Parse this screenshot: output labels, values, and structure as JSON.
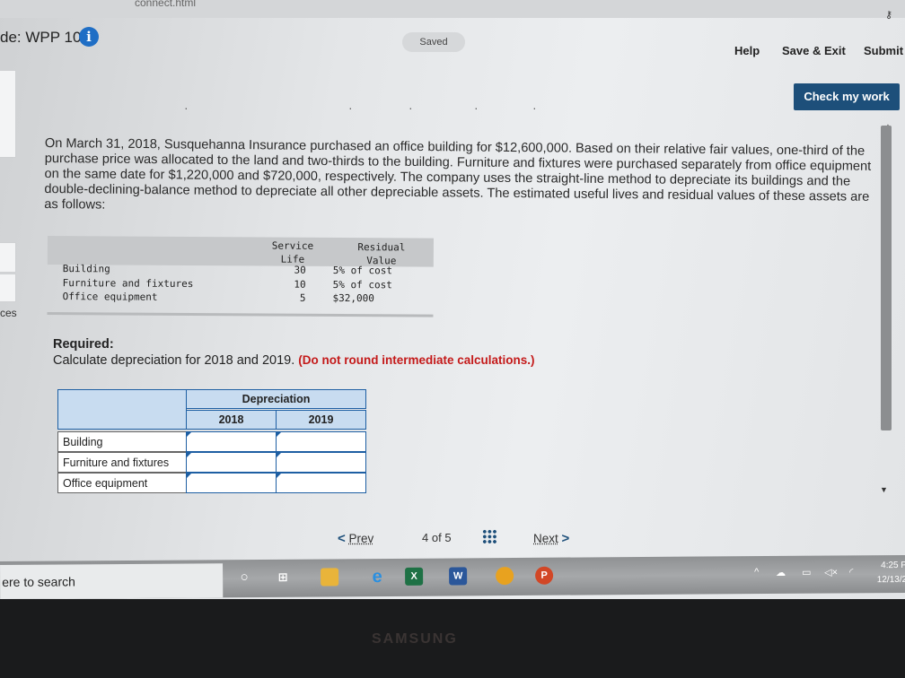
{
  "browser": {
    "url_fragment": "connect.html",
    "key_icon": "key-icon"
  },
  "header": {
    "title": "de: WPP 10",
    "info_icon_glyph": "i",
    "saved_label": "Saved",
    "help_label": "Help",
    "save_exit_label": "Save & Exit",
    "submit_label": "Submit"
  },
  "check_button_label": "Check my work",
  "sidebar": {
    "partial_label": "ces"
  },
  "problem_text": "On March 31, 2018, Susquehanna Insurance purchased an office building for $12,600,000. Based on their relative fair values, one-third of the purchase price was allocated to the land and two-thirds to the building. Furniture and fixtures were purchased separately from office equipment on the same date for $1,220,000 and $720,000, respectively. The company uses the straight-line method to depreciate its buildings and the double-declining-balance method to depreciate all other depreciable assets. The estimated useful lives and residual values of these assets are as follows:",
  "life_table": {
    "col_life_line1": "Service",
    "col_life_line2": "Life",
    "col_res_line1": "Residual",
    "col_res_line2": "Value",
    "rows": [
      {
        "asset": "Building",
        "life": "30",
        "residual": "5% of cost"
      },
      {
        "asset": "Furniture and fixtures",
        "life": "10",
        "residual": "5% of cost"
      },
      {
        "asset": "Office equipment",
        "life": "5",
        "residual": "$32,000"
      }
    ]
  },
  "required": {
    "heading": "Required:",
    "instruction": "Calculate depreciation for 2018 and 2019.",
    "note": "(Do not round intermediate calculations.)"
  },
  "answer_grid": {
    "group_header": "Depreciation",
    "col_2018": "2018",
    "col_2019": "2019",
    "rows": [
      {
        "label": "Building",
        "val_2018": "",
        "val_2019": ""
      },
      {
        "label": "Furniture and fixtures",
        "val_2018": "",
        "val_2019": ""
      },
      {
        "label": "Office equipment",
        "val_2018": "",
        "val_2019": ""
      }
    ]
  },
  "pager": {
    "prev_label": "Prev",
    "current": "4",
    "of_label": "of",
    "total": "5",
    "next_label": "Next"
  },
  "taskbar": {
    "search_text": "ere to search",
    "apps": [
      "cortana-icon",
      "task-view-icon",
      "file-explorer-icon",
      "edge-icon",
      "excel-icon",
      "word-icon",
      "chrome-icon",
      "powerpoint-icon"
    ],
    "clock_time": "4:25 P",
    "clock_date": "12/13/2"
  },
  "bezel_logo": "SAMSUNG",
  "colors": {
    "accent": "#1d4f7a",
    "grid_blue": "#1e5fa3",
    "grid_fill": "#c8dcf0",
    "note_red": "#c41a1a",
    "info_blue": "#1f6ec5"
  }
}
